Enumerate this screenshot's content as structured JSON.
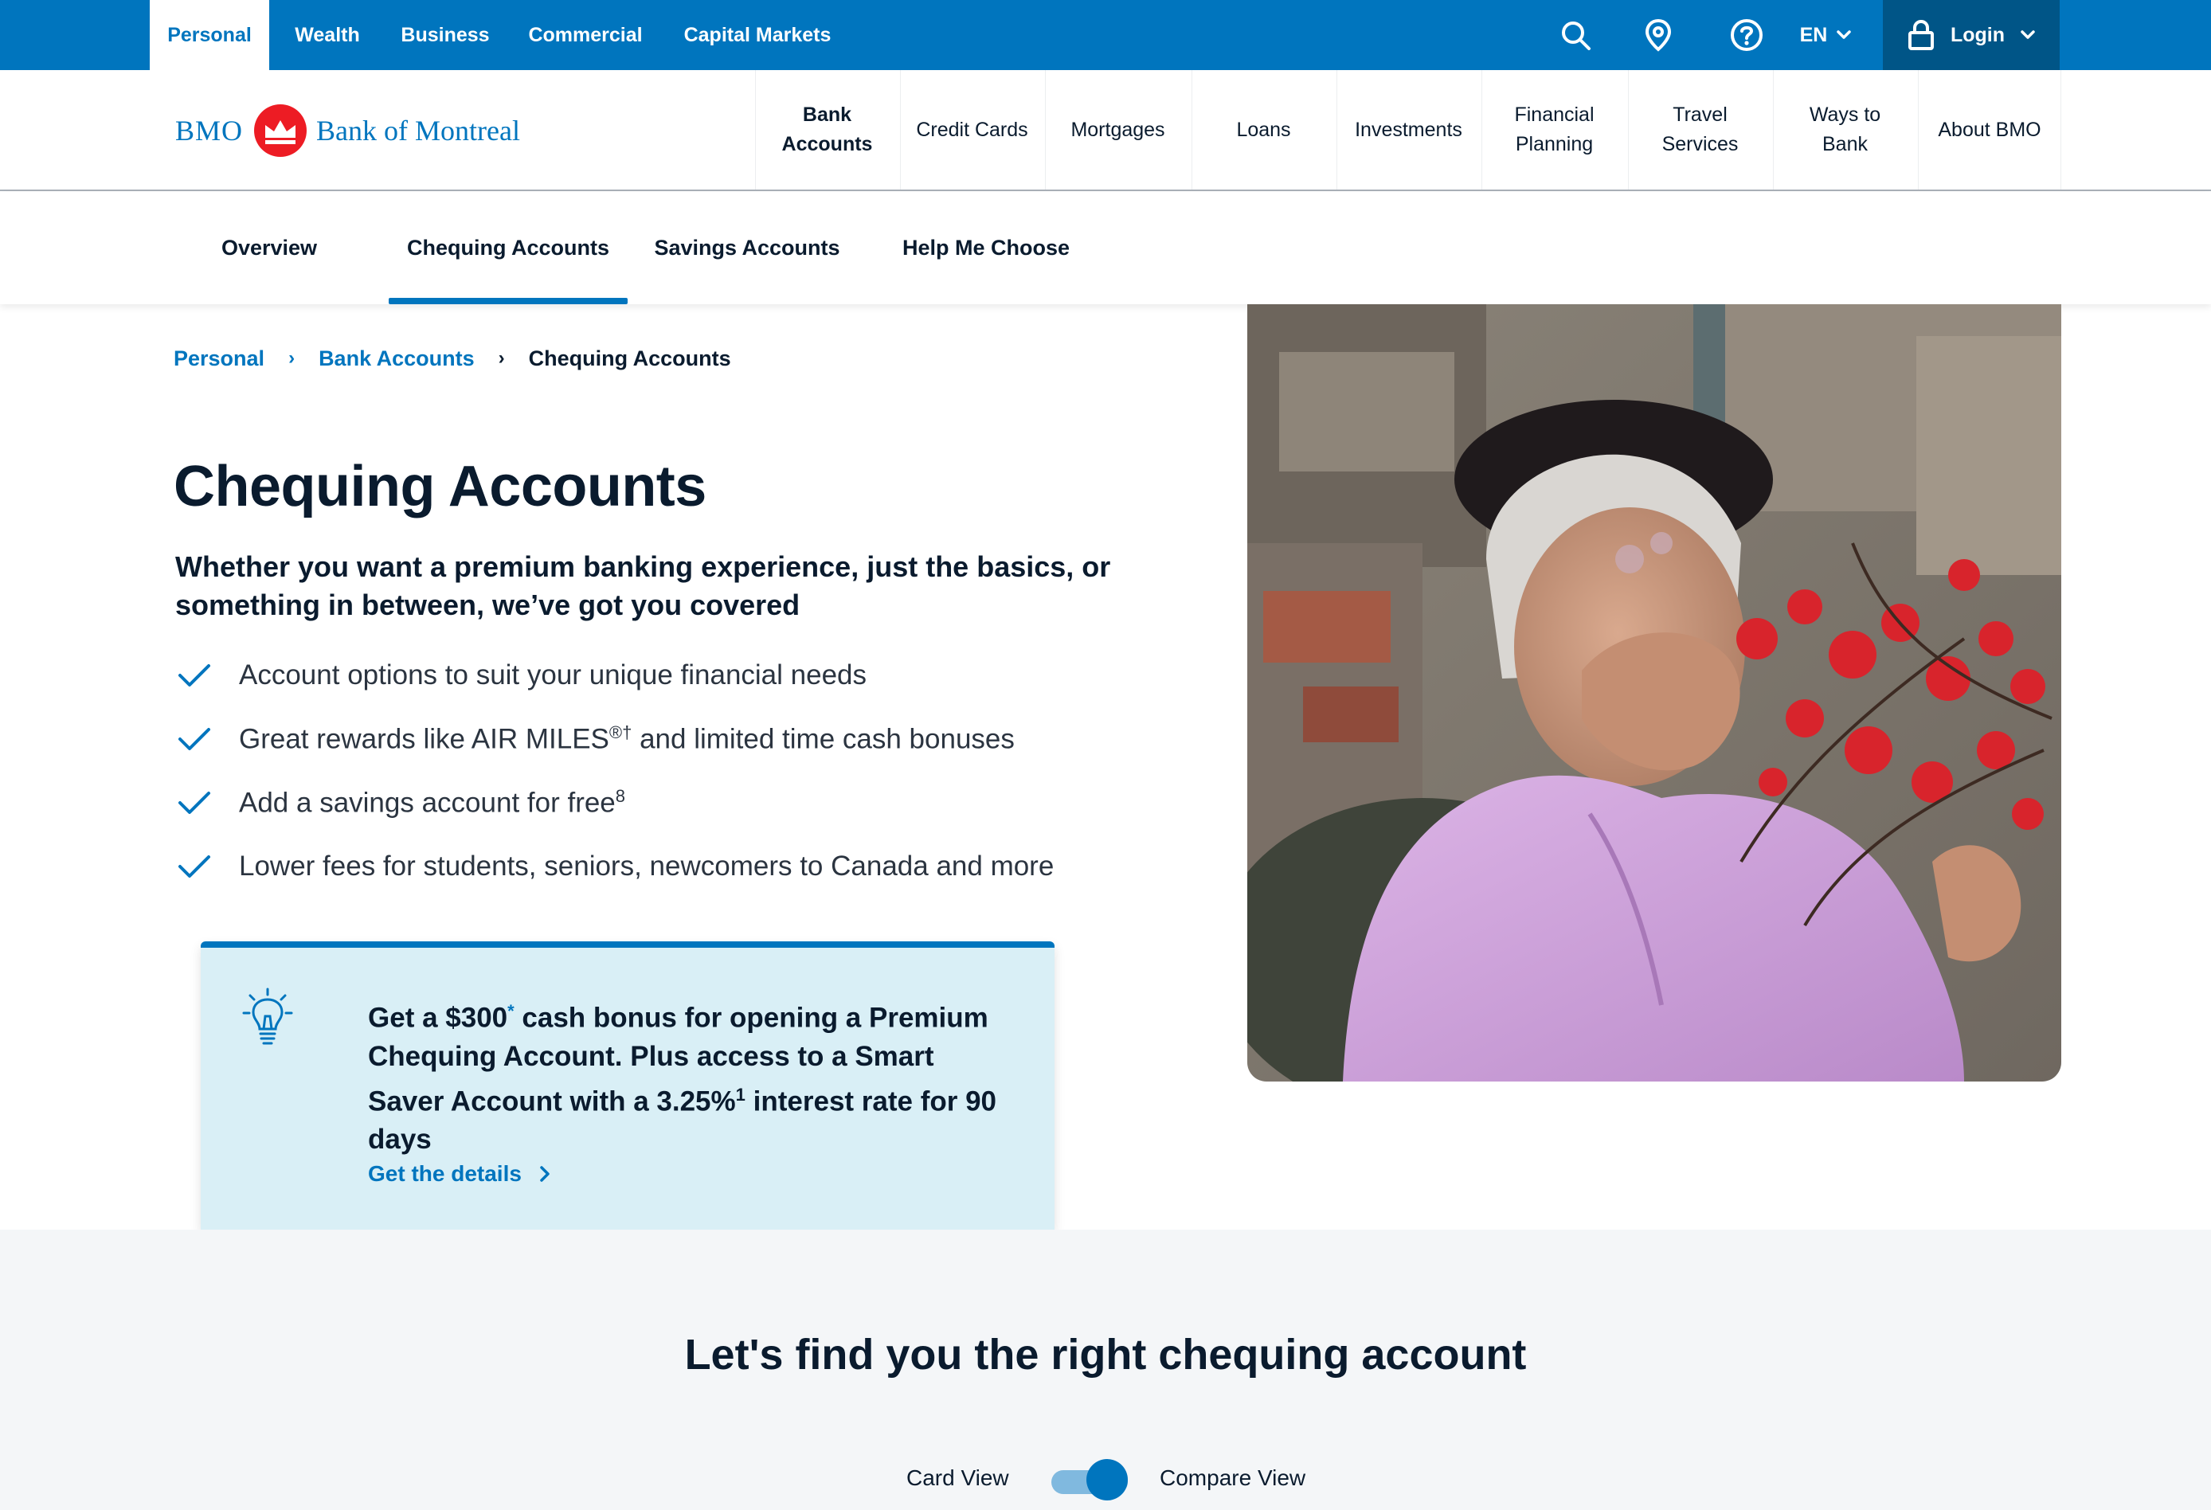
{
  "topbar": {
    "segments": [
      "Personal",
      "Wealth",
      "Business",
      "Commercial",
      "Capital Markets"
    ],
    "active_segment": "Personal",
    "language": "EN",
    "login_label": "Login",
    "icons": [
      "search-icon",
      "location-pin-icon",
      "help-icon",
      "chevron-down-icon",
      "lock-icon"
    ],
    "bg_color": "#0075be"
  },
  "logo": {
    "bmo_text": "BMO",
    "bank_text": "Bank of Montreal",
    "roundel_color": "#ed1c24"
  },
  "main_nav": {
    "items": [
      {
        "line1": "Bank",
        "line2": "Accounts"
      },
      {
        "line1": "Credit Cards",
        "line2": ""
      },
      {
        "line1": "Mortgages",
        "line2": ""
      },
      {
        "line1": "Loans",
        "line2": ""
      },
      {
        "line1": "Investments",
        "line2": ""
      },
      {
        "line1": "Financial",
        "line2": "Planning"
      },
      {
        "line1": "Travel",
        "line2": "Services"
      },
      {
        "line1": "Ways to",
        "line2": "Bank"
      },
      {
        "line1": "About BMO",
        "line2": ""
      }
    ]
  },
  "sub_nav": {
    "tabs": [
      "Overview",
      "Chequing Accounts",
      "Savings Accounts",
      "Help Me Choose"
    ],
    "active": "Chequing Accounts"
  },
  "breadcrumb": {
    "items": [
      "Personal",
      "Bank Accounts",
      "Chequing Accounts"
    ]
  },
  "hero": {
    "title": "Chequing Accounts",
    "lead": "Whether you want a premium banking experience, just the basics, or something in between, we’ve got you covered",
    "bullets": [
      {
        "text": "Account options to suit your unique financial needs",
        "sup": ""
      },
      {
        "text": "Great rewards like AIR MILES",
        "sup": "®†",
        "tail": " and limited time cash bonuses"
      },
      {
        "text": "Add a savings account for free",
        "sup": "8",
        "tail": ""
      },
      {
        "text": "Lower fees for students, seniors, newcomers to Canada and more",
        "sup": "",
        "tail": ""
      }
    ],
    "image_alt": "smiling-woman-with-red-flowers-photo"
  },
  "promo": {
    "part1": "Get a $300",
    "ast": "*",
    "part2": " cash bonus for opening a Premium Chequing Account. Plus access to a Smart Saver Account with a 3.25%",
    "sup": "1",
    "part3": " interest rate for 90 days",
    "cta": "Get the details",
    "accent": "#0075be",
    "bg": "#d9eff6"
  },
  "finder": {
    "title": "Let's find you the right chequing account",
    "left_label": "Card View",
    "right_label": "Compare View",
    "toggle_state": "Compare View"
  }
}
